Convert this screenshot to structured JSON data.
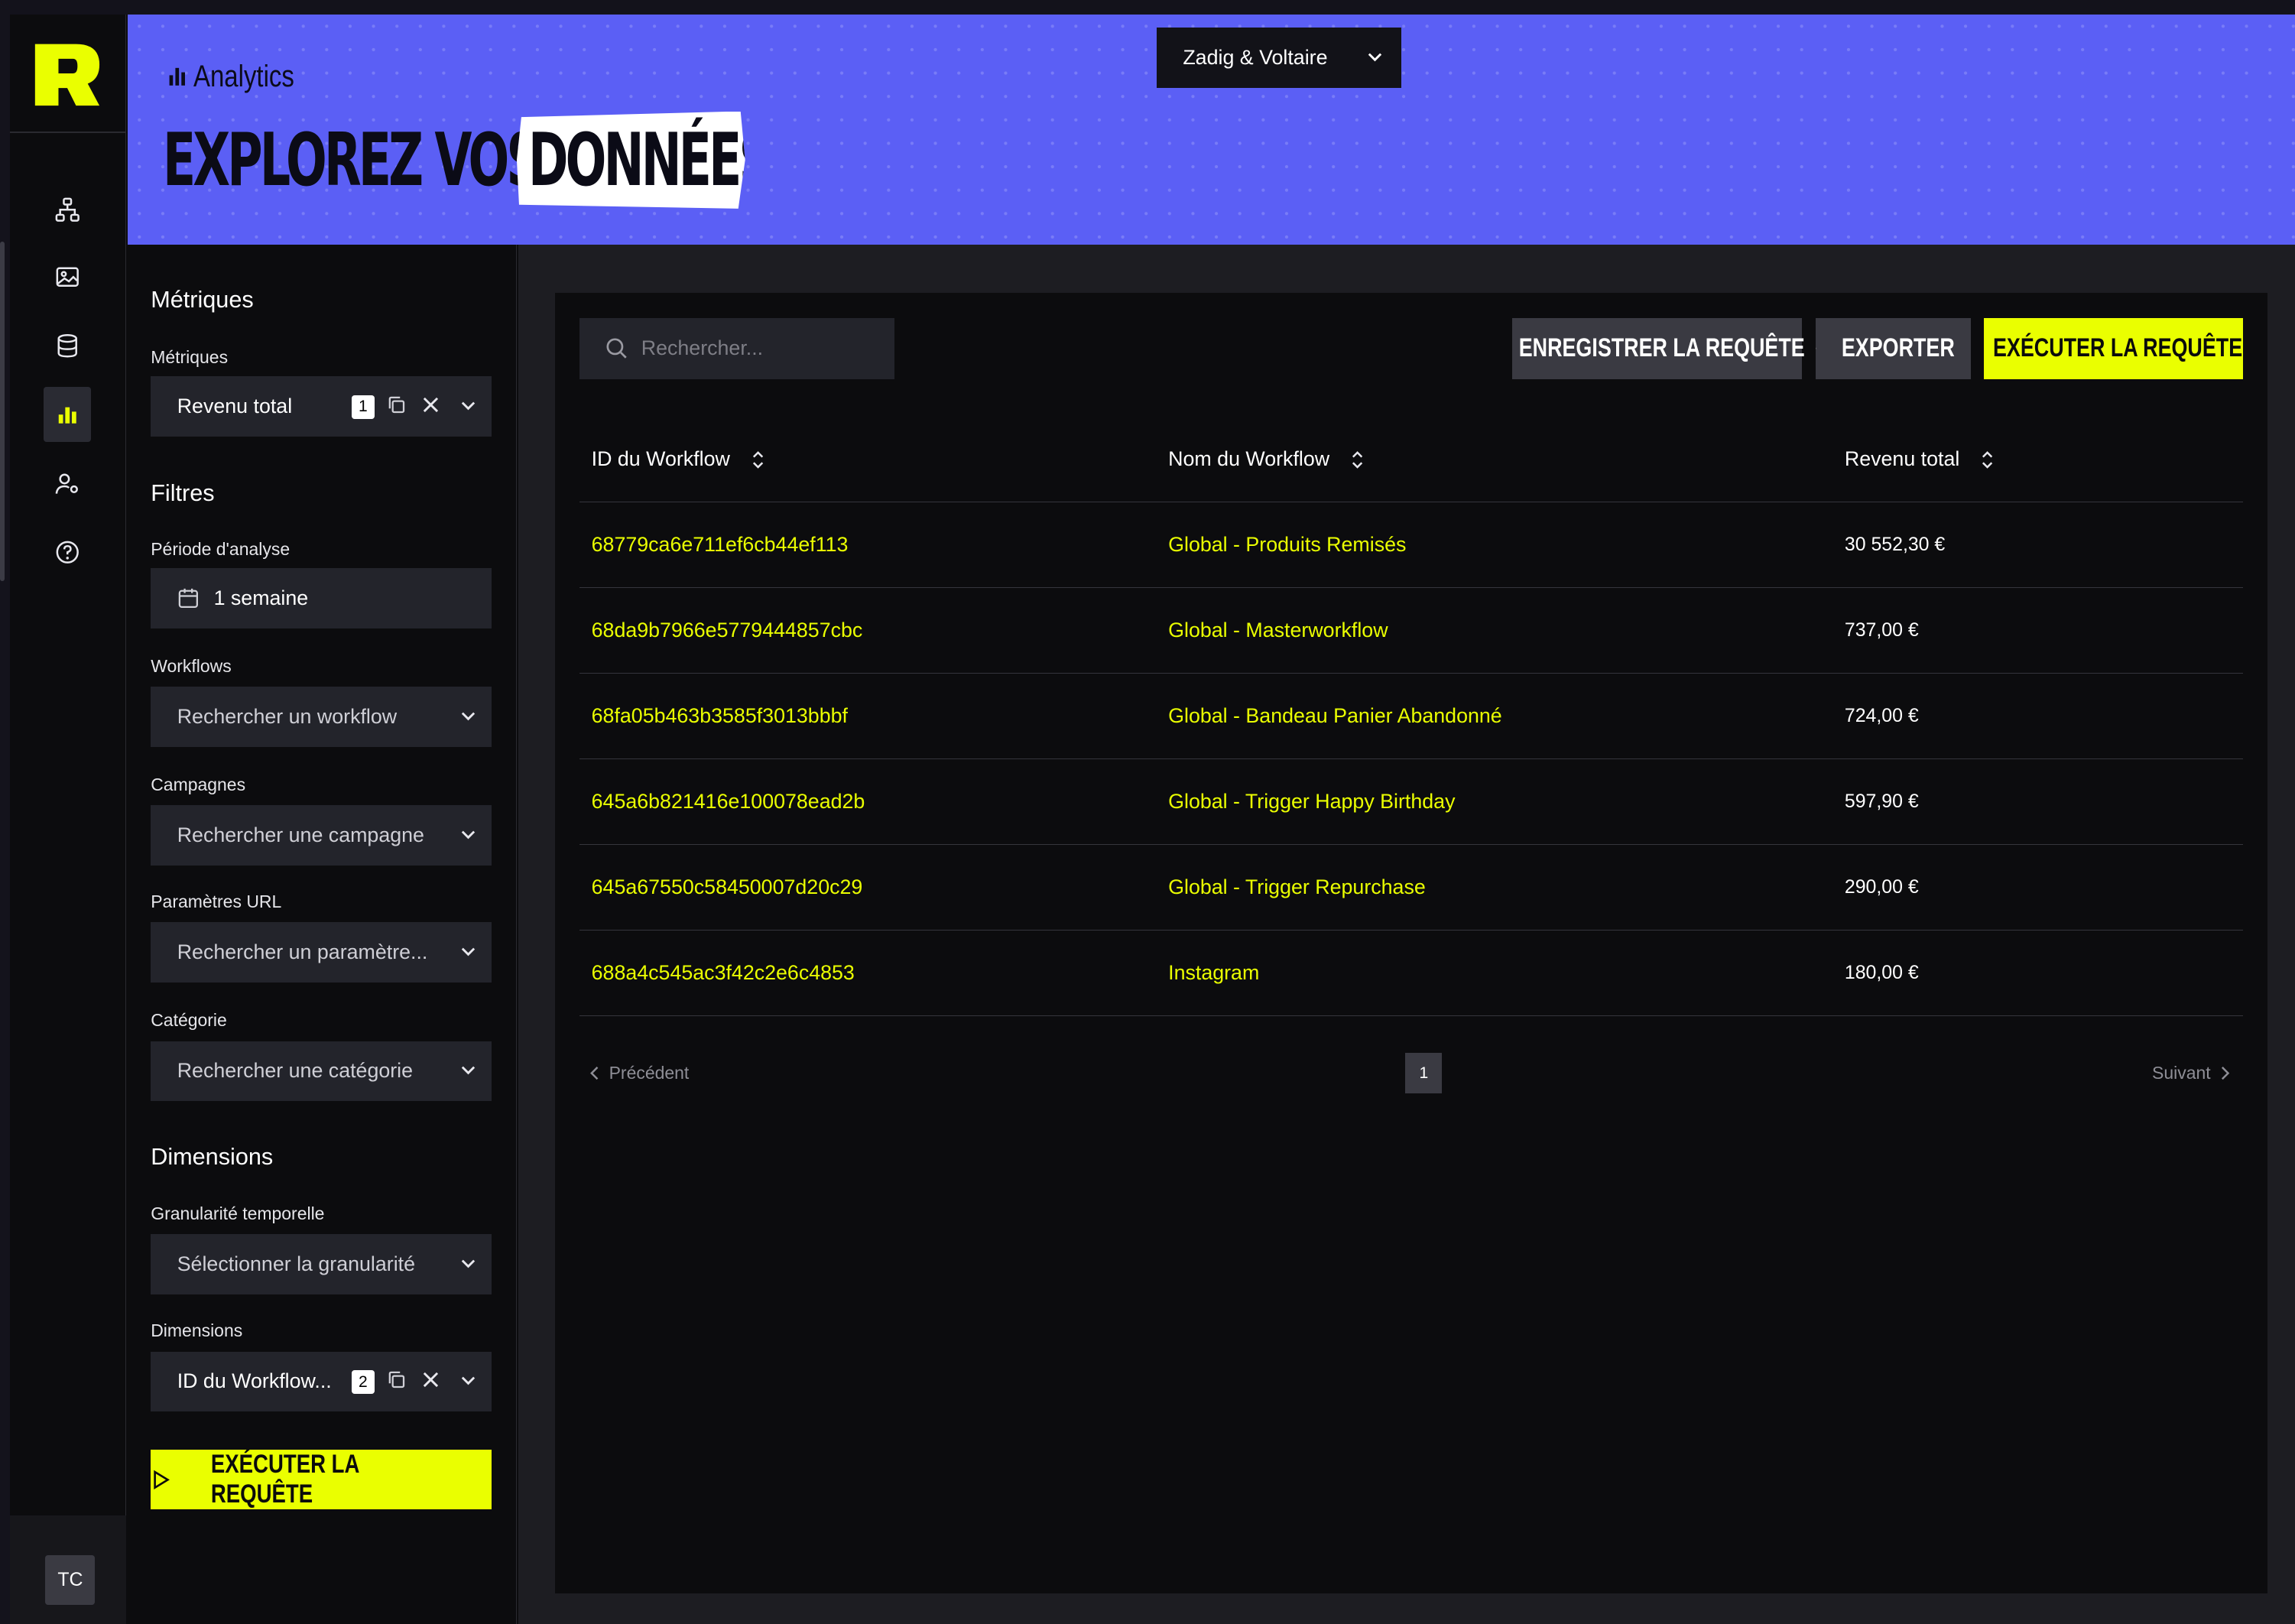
{
  "header": {
    "breadcrumb": "Analytics",
    "title_part1": "EXPLOREZ VOS",
    "title_part2": "DONNÉES",
    "store_selector": "Zadig & Voltaire",
    "banner_color": "#5b5ff5"
  },
  "nav": {
    "items": [
      "workflow-icon",
      "gallery-icon",
      "database-icon",
      "analytics-icon",
      "user-settings-icon",
      "help-icon"
    ],
    "active_item": "analytics-icon",
    "avatar": "TC"
  },
  "filters": {
    "metrics_heading": "Métriques",
    "metrics_label": "Métriques",
    "metrics_value": "Revenu total",
    "metrics_count": "1",
    "filters_heading": "Filtres",
    "period_label": "Période d'analyse",
    "period_value": "1 semaine",
    "workflows_label": "Workflows",
    "workflows_placeholder": "Rechercher un workflow",
    "campaigns_label": "Campagnes",
    "campaigns_placeholder": "Rechercher une campagne",
    "url_params_label": "Paramètres URL",
    "url_params_placeholder": "Rechercher un paramètre...",
    "category_label": "Catégorie",
    "category_placeholder": "Rechercher une catégorie",
    "dimensions_heading": "Dimensions",
    "granularity_label": "Granularité temporelle",
    "granularity_placeholder": "Sélectionner la granularité",
    "dimensions_label": "Dimensions",
    "dimensions_value": "ID du Workflow...",
    "dimensions_count": "2",
    "run_button": "EXÉCUTER LA REQUÊTE"
  },
  "toolbar": {
    "search_placeholder": "Rechercher...",
    "save_button": "ENREGISTRER LA REQUÊTE",
    "export_button": "EXPORTER",
    "run_button": "EXÉCUTER LA REQUÊTE",
    "accent_color": "#eaff00"
  },
  "table": {
    "columns": [
      "ID du Workflow",
      "Nom du Workflow",
      "Revenu total"
    ],
    "rows": [
      {
        "id": "68779ca6e711ef6cb44ef113",
        "name": "Global - Produits Remisés",
        "revenue": "30 552,30 €"
      },
      {
        "id": "68da9b7966e5779444857cbc",
        "name": "Global - Masterworkflow",
        "revenue": "737,00 €"
      },
      {
        "id": "68fa05b463b3585f3013bbbf",
        "name": "Global - Bandeau Panier Abandonné",
        "revenue": "724,00 €"
      },
      {
        "id": "645a6b821416e100078ead2b",
        "name": "Global - Trigger Happy Birthday",
        "revenue": "597,90 €"
      },
      {
        "id": "645a67550c58450007d20c29",
        "name": "Global - Trigger Repurchase",
        "revenue": "290,00 €"
      },
      {
        "id": "688a4c545ac3f42c2e6c4853",
        "name": "Instagram",
        "revenue": "180,00 €"
      }
    ]
  },
  "pagination": {
    "prev": "Précédent",
    "next": "Suivant",
    "current_page": "1"
  }
}
